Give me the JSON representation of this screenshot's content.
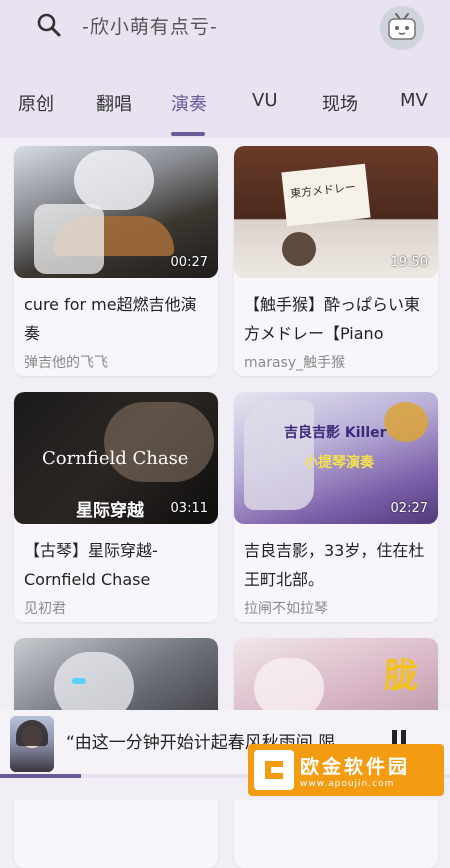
{
  "header": {
    "search_text": "-欣小萌有点亏-",
    "tabs": [
      {
        "label": "原创",
        "active": false
      },
      {
        "label": "翻唱",
        "active": false
      },
      {
        "label": "演奏",
        "active": true
      },
      {
        "label": "VU",
        "active": false
      },
      {
        "label": "现场",
        "active": false
      },
      {
        "label": "MV",
        "active": false
      }
    ]
  },
  "cards": [
    {
      "title": "cure for me超燃吉他演奏",
      "author": "弹吉他的飞飞",
      "duration": "00:27"
    },
    {
      "title": "【触手猴】酔っぱらい東方メドレー【Piano",
      "author": "marasy_触手猴",
      "duration": "19:50",
      "overlay": "東方メドレー"
    },
    {
      "title": "【古琴】星际穿越-Cornfield Chase",
      "author": "见初君",
      "duration": "03:11",
      "overlay": "Cornfield Chase",
      "overlay2": "星际穿越"
    },
    {
      "title": "吉良吉影，33岁，住在杜王町北部。",
      "author": "拉闸不如拉琴",
      "duration": "02:27",
      "overlay": "吉良吉影 Killer",
      "overlay2": "小提琴演奏"
    },
    {
      "title": "",
      "author": "",
      "duration": ""
    },
    {
      "title": "",
      "author": "",
      "duration": "",
      "overlay": "胧"
    }
  ],
  "player": {
    "title": "“由这一分钟开始计起春风秋雨间 限…",
    "progress": 0.18
  },
  "watermark": {
    "main": "欧金软件园",
    "sub": "www.apoujin.com"
  },
  "colors": {
    "accent": "#6b5a9a",
    "header_bg": "#e9e3f1",
    "watermark_bg": "#f39c12"
  }
}
